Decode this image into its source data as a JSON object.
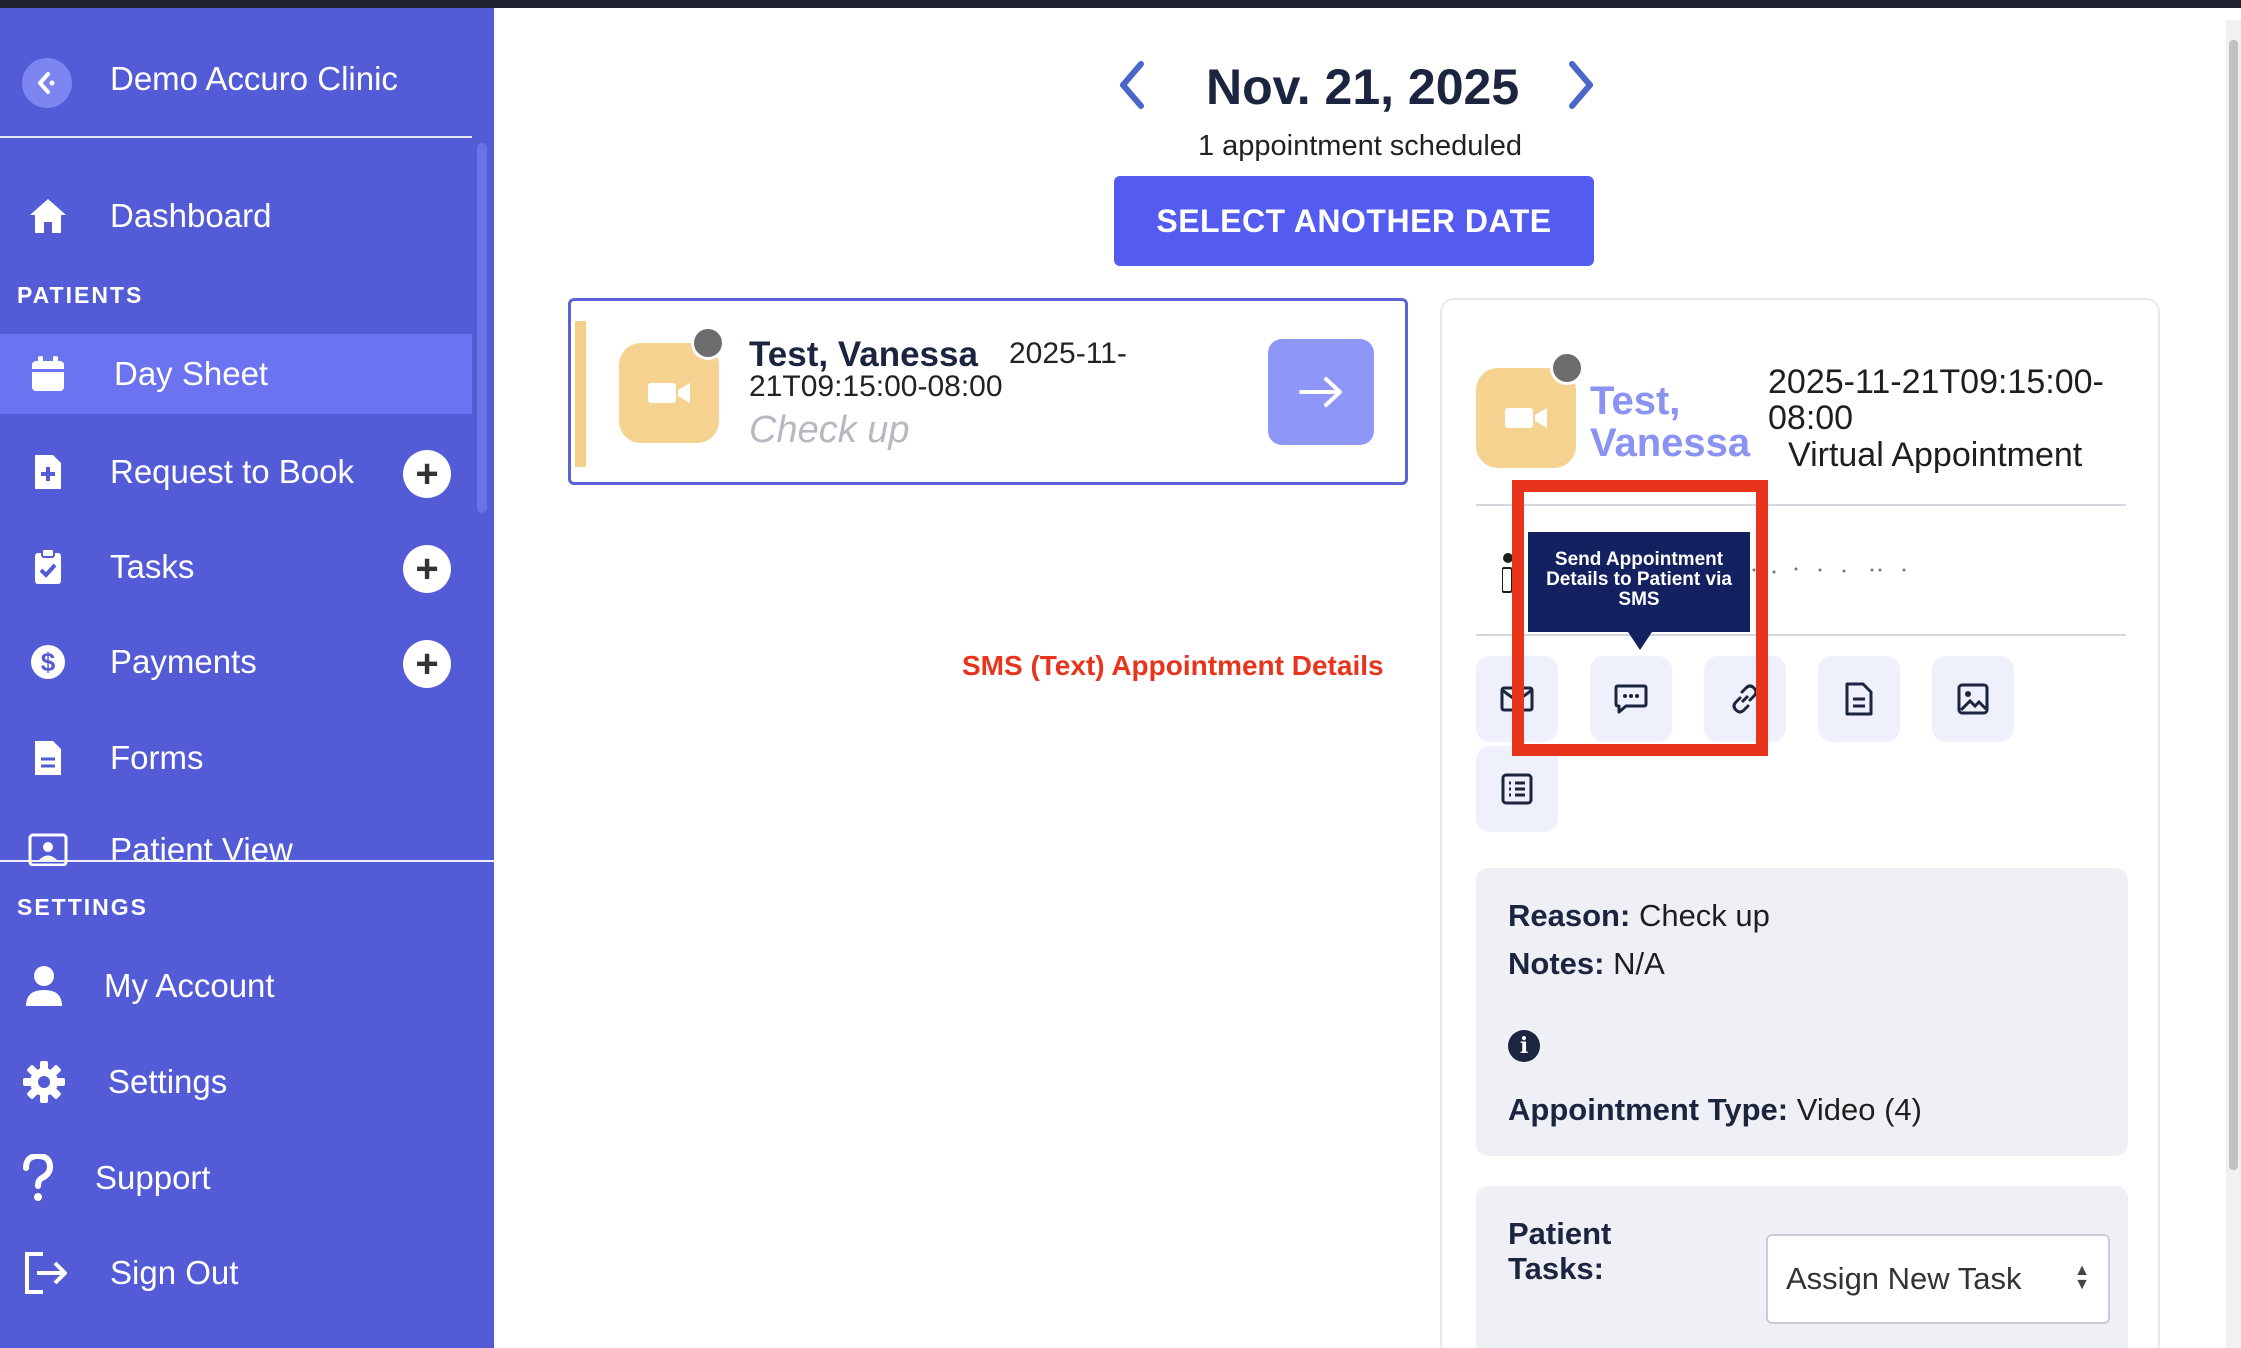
{
  "sidebar": {
    "clinic_name": "Demo Accuro Clinic",
    "patients_label": "PATIENTS",
    "settings_label": "SETTINGS",
    "items": [
      {
        "label": "Dashboard",
        "icon": "home-icon"
      },
      {
        "label": "Day Sheet",
        "icon": "calendar-icon",
        "active": true
      },
      {
        "label": "Request to Book",
        "icon": "file-plus-icon",
        "has_add": true
      },
      {
        "label": "Tasks",
        "icon": "clipboard-check-icon",
        "has_add": true
      },
      {
        "label": "Payments",
        "icon": "dollar-icon",
        "has_add": true
      },
      {
        "label": "Forms",
        "icon": "file-icon"
      },
      {
        "label": "Patient View",
        "icon": "id-card-icon"
      }
    ],
    "settings_items": [
      {
        "label": "My Account",
        "icon": "user-icon"
      },
      {
        "label": "Settings",
        "icon": "gear-icon"
      },
      {
        "label": "Support",
        "icon": "question-icon"
      },
      {
        "label": "Sign Out",
        "icon": "sign-out-icon"
      }
    ],
    "add_symbol": "+"
  },
  "main": {
    "date": "Nov. 21, 2025",
    "appointment_count": "1 appointment scheduled",
    "select_date_label": "SELECT ANOTHER DATE"
  },
  "appointment_card": {
    "patient_name": "Test, Vanessa",
    "time": "2025-11-21T09:15:00-08:00",
    "reason": "Check up"
  },
  "annotation": {
    "text": "SMS (Text) Appointment Details",
    "color": "#e9341c"
  },
  "detail": {
    "patient_name": "Test, Vanessa",
    "time": "2025-11-21T09:15:00-08:00",
    "type": "Virtual Appointment",
    "tooltip": "Send Appointment Details to Patient via SMS",
    "reason_label": "Reason:",
    "reason_value": "Check up",
    "notes_label": "Notes:",
    "notes_value": "N/A",
    "appt_type_label": "Appointment Type:",
    "appt_type_value": "Video (4)",
    "tasks_label": "Patient Tasks:",
    "tasks_select_value": "Assign New Task"
  },
  "colors": {
    "sidebar": "#535bd6",
    "accent": "#535bf0",
    "video_tile": "#f5d28f",
    "highlight": "#e9341c"
  }
}
